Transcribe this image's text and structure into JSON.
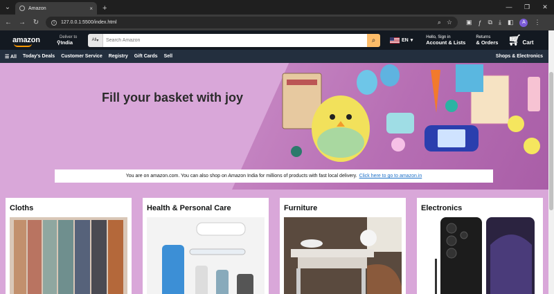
{
  "browser": {
    "tab_title": "Amazon",
    "tab_close": "×",
    "new_tab": "+",
    "url": "127.0.0.1:5500/index.html",
    "profile_initial": "A"
  },
  "header": {
    "logo": "amazon",
    "deliver_small": "Deliver to",
    "deliver_big": "India",
    "search_category": "All",
    "search_placeholder": "Search Amazon",
    "lang": "EN",
    "account_small": "Hello, Sign in",
    "account_big": "Account & Lists",
    "returns_small": "Returns",
    "returns_big": "& Orders",
    "cart": "Cart"
  },
  "nav": {
    "all": "☰ All",
    "items": [
      "Today's Deals",
      "Customer Service",
      "Registry",
      "Gift Cards",
      "Sell"
    ],
    "right": "Shops & Electronics"
  },
  "hero": {
    "headline": "Fill your basket with joy",
    "notice_text": "You are on amazon.com. You can also shop on Amazon India for millions of products with fast local delivery.",
    "notice_link": "Click here to go to amazon.in"
  },
  "cards": [
    {
      "title": "Cloths"
    },
    {
      "title": "Health & Personal Care"
    },
    {
      "title": "Furniture"
    },
    {
      "title": "Electronics"
    }
  ],
  "colors": {
    "amazon_dark": "#131921",
    "amazon_nav": "#232f3e",
    "search_button": "#febd69",
    "page_bg": "#d9a7d9"
  }
}
